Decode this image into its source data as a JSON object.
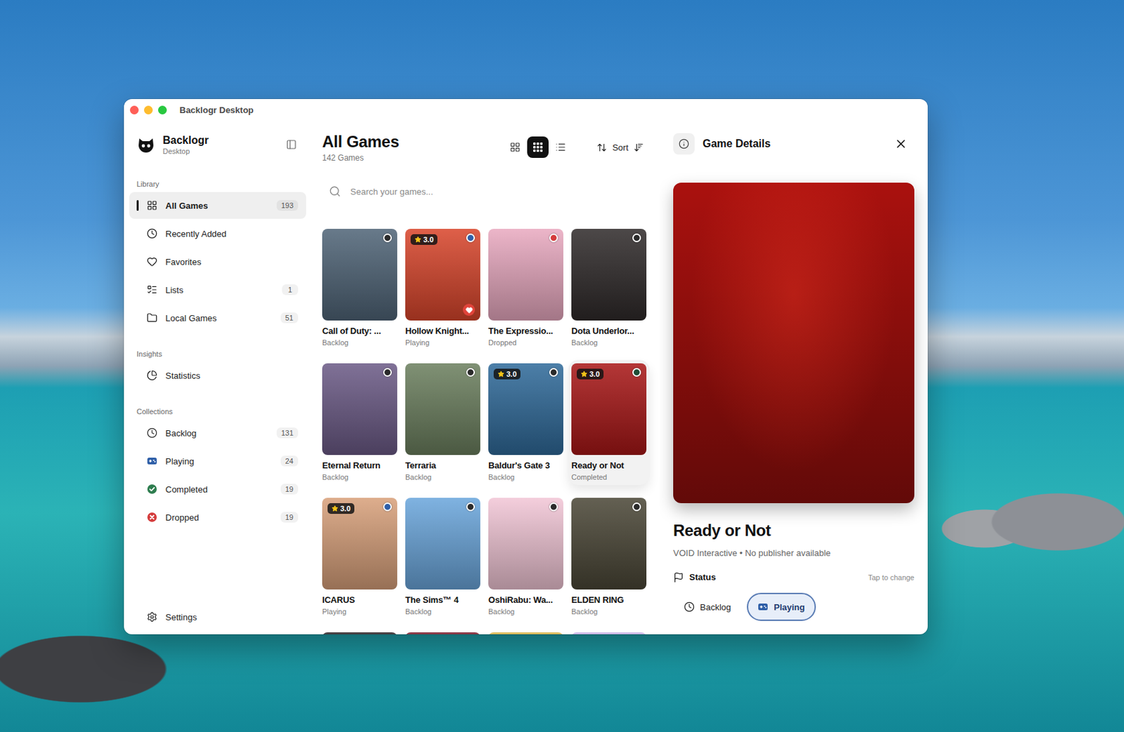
{
  "window": {
    "title": "Backlogr Desktop"
  },
  "app": {
    "name": "Backlogr",
    "subtitle": "Desktop"
  },
  "sidebar": {
    "sections": [
      {
        "label": "Library",
        "items": [
          {
            "label": "All Games",
            "count": "193",
            "selected": true
          },
          {
            "label": "Recently Added",
            "count": null,
            "selected": false
          },
          {
            "label": "Favorites",
            "count": null,
            "selected": false
          },
          {
            "label": "Lists",
            "count": "1",
            "selected": false
          },
          {
            "label": "Local Games",
            "count": "51",
            "selected": false
          }
        ]
      },
      {
        "label": "Insights",
        "items": [
          {
            "label": "Statistics",
            "count": null,
            "selected": false
          }
        ]
      },
      {
        "label": "Collections",
        "items": [
          {
            "label": "Backlog",
            "count": "131",
            "selected": false,
            "color": "#2a2a2a"
          },
          {
            "label": "Playing",
            "count": "24",
            "selected": false,
            "color": "#2f5fa8"
          },
          {
            "label": "Completed",
            "count": "19",
            "selected": false,
            "color": "#2e7d4f"
          },
          {
            "label": "Dropped",
            "count": "19",
            "selected": false,
            "color": "#d43b3b"
          }
        ]
      }
    ],
    "footer": {
      "label": "Settings",
      "selected": false
    }
  },
  "library": {
    "title": "All Games",
    "subtitle": "142 Games",
    "views": [
      {
        "selected": false
      },
      {
        "selected": true
      },
      {
        "selected": false
      }
    ],
    "sort": "Sort",
    "search": {
      "placeholder": "Search your games..."
    }
  },
  "games": [
    {
      "title": "Call of Duty: ...",
      "status": "Backlog",
      "color": "#2a2a2a",
      "cover": "#4f6477",
      "rating": null,
      "favorite": false,
      "selected": false
    },
    {
      "title": "Hollow Knight...",
      "status": "Playing",
      "color": "#2f5fa8",
      "cover": "#d9452b",
      "rating": "3.0",
      "favorite": true,
      "selected": false
    },
    {
      "title": "The Expressio...",
      "status": "Dropped",
      "color": "#d43b3b",
      "cover": "#e9a9c0",
      "rating": null,
      "favorite": false,
      "selected": false
    },
    {
      "title": "Dota Underlor...",
      "status": "Backlog",
      "color": "#2a2a2a",
      "cover": "#2f2a2a",
      "rating": null,
      "favorite": false,
      "selected": false
    },
    {
      "title": "Eternal Return",
      "status": "Backlog",
      "color": "#2a2a2a",
      "cover": "#6b5a86",
      "rating": null,
      "favorite": false,
      "selected": false
    },
    {
      "title": "Terraria",
      "status": "Backlog",
      "color": "#2a2a2a",
      "cover": "#6b7f5e",
      "rating": null,
      "favorite": false,
      "selected": false
    },
    {
      "title": "Baldur's Gate 3",
      "status": "Backlog",
      "color": "#2a2a2a",
      "cover": "#2f6a9a",
      "rating": "3.0",
      "favorite": false,
      "selected": false
    },
    {
      "title": "Ready or Not",
      "status": "Completed",
      "color": "#1f4d36",
      "cover": "#a81616",
      "rating": "3.0",
      "favorite": false,
      "selected": true
    },
    {
      "title": "ICARUS",
      "status": "Playing",
      "color": "#2f5fa8",
      "cover": "#d8a07a",
      "rating": "3.0",
      "favorite": false,
      "selected": false
    },
    {
      "title": "The Sims™ 4",
      "status": "Backlog",
      "color": "#2a2a2a",
      "cover": "#6aa6dc",
      "rating": null,
      "favorite": false,
      "selected": false
    },
    {
      "title": "OshiRabu: Wa...",
      "status": "Backlog",
      "color": "#2a2a2a",
      "cover": "#f2c6d6",
      "rating": null,
      "favorite": false,
      "selected": false
    },
    {
      "title": "ELDEN RING",
      "status": "Backlog",
      "color": "#2a2a2a",
      "cover": "#4a4636",
      "rating": null,
      "favorite": false,
      "selected": false
    }
  ],
  "partial_covers": [
    {
      "cover": "#2b2226"
    },
    {
      "cover": "#7a1c2c"
    },
    {
      "cover": "#d9b54a"
    },
    {
      "cover": "#c9b3e6"
    }
  ],
  "details": {
    "header": "Game Details",
    "cover": "#b3120f",
    "title": "Ready or Not",
    "meta": "VOID Interactive • No publisher available",
    "status_label": "Status",
    "status_hint": "Tap to change",
    "chips": [
      {
        "label": "Backlog",
        "selected": false
      },
      {
        "label": "Playing",
        "selected": true
      }
    ]
  }
}
